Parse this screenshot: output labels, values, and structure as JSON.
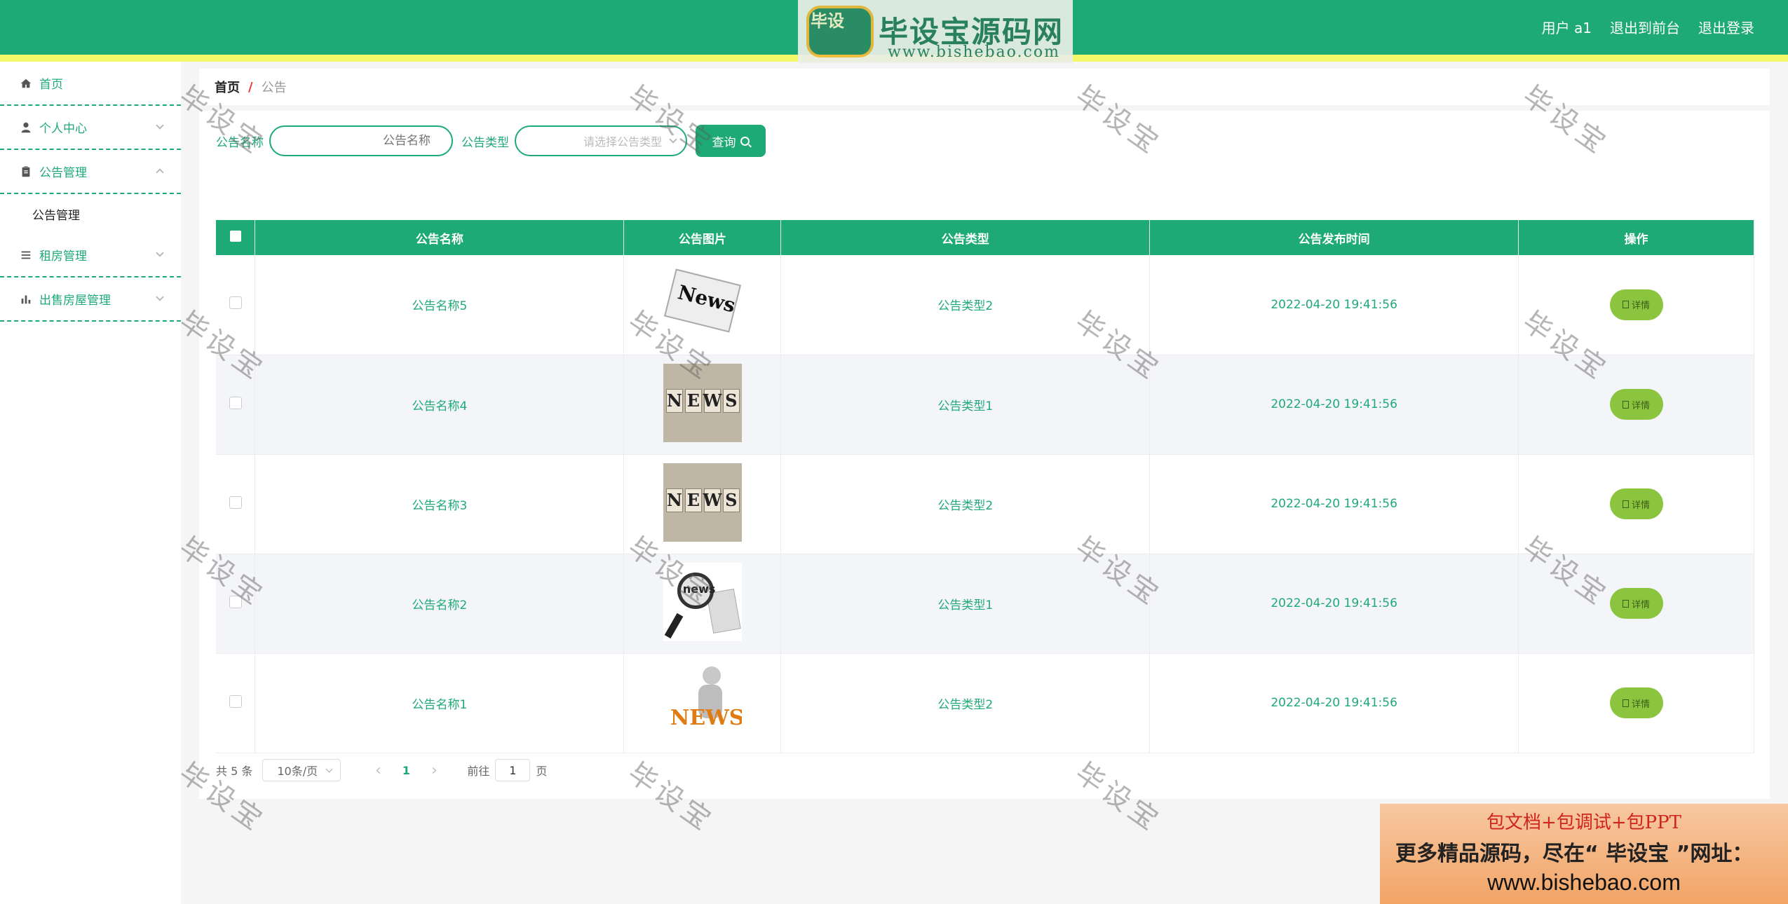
{
  "header": {
    "user_label": "用户 a1",
    "to_front_label": "退出到前台",
    "logout_label": "退出登录",
    "logo_badge": "毕设",
    "logo_brand": "毕设宝源码网",
    "logo_url": "www.bishebao.com"
  },
  "sidebar": {
    "items": [
      {
        "label": "首页",
        "icon": "home-icon"
      },
      {
        "label": "个人中心",
        "icon": "user-icon"
      },
      {
        "label": "公告管理",
        "icon": "clipboard-icon"
      },
      {
        "label": "租房管理",
        "icon": "list-icon"
      },
      {
        "label": "出售房屋管理",
        "icon": "bar-chart-icon"
      }
    ],
    "sub_item": "公告管理"
  },
  "breadcrumb": {
    "home": "首页",
    "sep": "/",
    "current": "公告"
  },
  "search": {
    "name_label": "公告名称",
    "name_placeholder": "公告名称",
    "type_label": "公告类型",
    "type_placeholder": "请选择公告类型",
    "query_label": "查询"
  },
  "table": {
    "headers": [
      "公告名称",
      "公告图片",
      "公告类型",
      "公告发布时间",
      "操作"
    ],
    "rows": [
      {
        "name": "公告名称5",
        "type": "公告类型2",
        "time": "2022-04-20 19:41:56",
        "image_text": "News"
      },
      {
        "name": "公告名称4",
        "type": "公告类型1",
        "time": "2022-04-20 19:41:56",
        "image_text": "NEWS"
      },
      {
        "name": "公告名称3",
        "type": "公告类型2",
        "time": "2022-04-20 19:41:56",
        "image_text": "NEWS"
      },
      {
        "name": "公告名称2",
        "type": "公告类型1",
        "time": "2022-04-20 19:41:56",
        "image_text": "news"
      },
      {
        "name": "公告名称1",
        "type": "公告类型2",
        "time": "2022-04-20 19:41:56",
        "image_text": "NEWS"
      }
    ],
    "detail_label": "详情"
  },
  "pagination": {
    "total": "共 5 条",
    "page_size": "10条/页",
    "current_page": "1",
    "goto_label": "前往",
    "goto_value": "1",
    "page_suffix": "页"
  },
  "watermark": "毕设宝",
  "ad": {
    "line1": "包文档+包调试+包PPT",
    "line2": "更多精品源码，尽在“ 毕设宝 ”网址：",
    "line3": "www.bishebao.com"
  },
  "colors": {
    "primary": "#1eaa76",
    "accent_stripe": "#f3f76a",
    "detail_button": "#8bc53f"
  }
}
